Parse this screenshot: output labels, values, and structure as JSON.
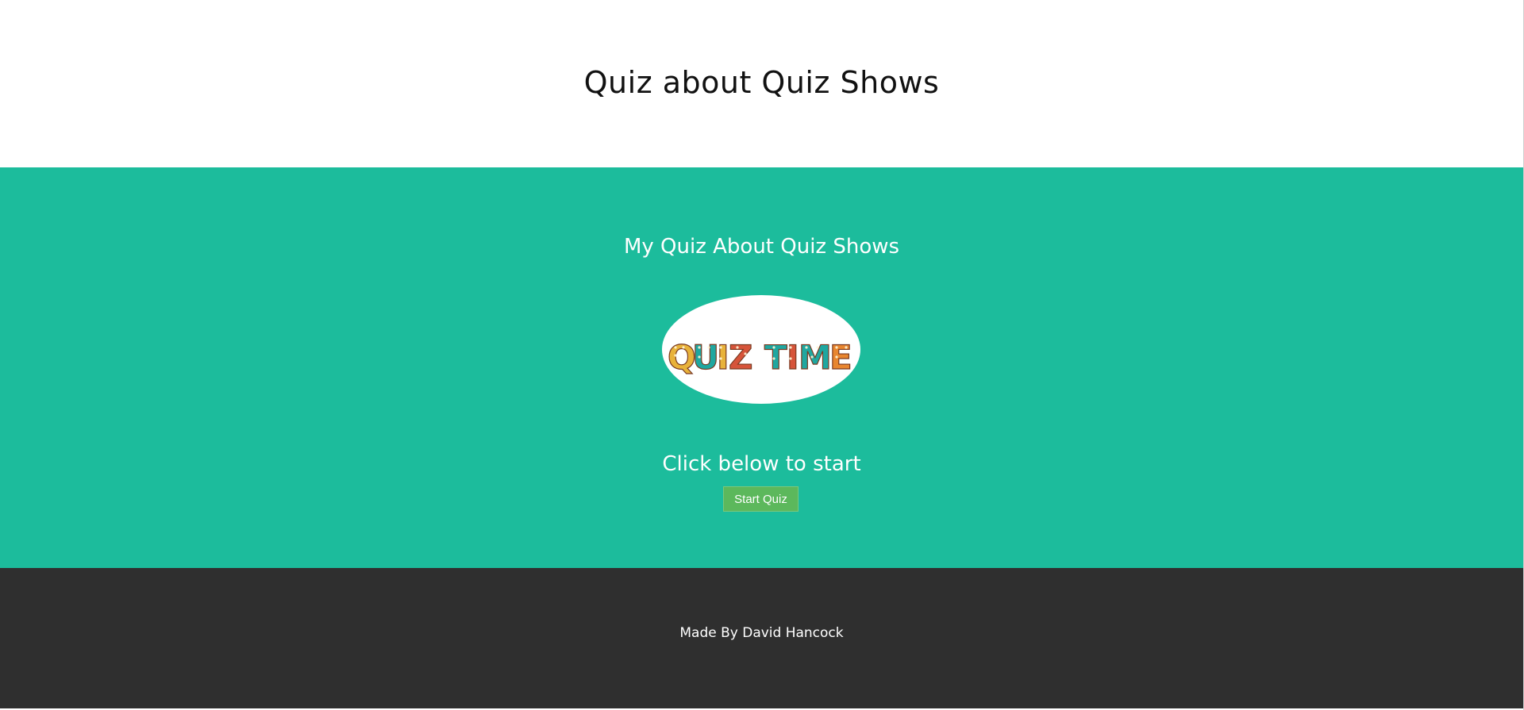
{
  "header": {
    "title": "Quiz about Quiz Shows"
  },
  "hero": {
    "title": "My Quiz About Quiz Shows",
    "logo": {
      "text": "QUIZ TIME",
      "alt": "Quiz Time logo",
      "colors": {
        "q": "#e8b23a",
        "u": "#1fa7a0",
        "i": "#e8b23a",
        "z": "#d6543a",
        "t": "#1fa7a0",
        "i2": "#d6543a",
        "m": "#1fa7a0",
        "e": "#e8862f"
      }
    },
    "start_prompt": "Click below to start",
    "start_button_label": "Start Quiz"
  },
  "footer": {
    "credit": "Made By David Hancock"
  },
  "colors": {
    "hero_background": "#1cbc9c",
    "footer_background": "#2f2f2f",
    "button_background": "#5cb85c"
  }
}
